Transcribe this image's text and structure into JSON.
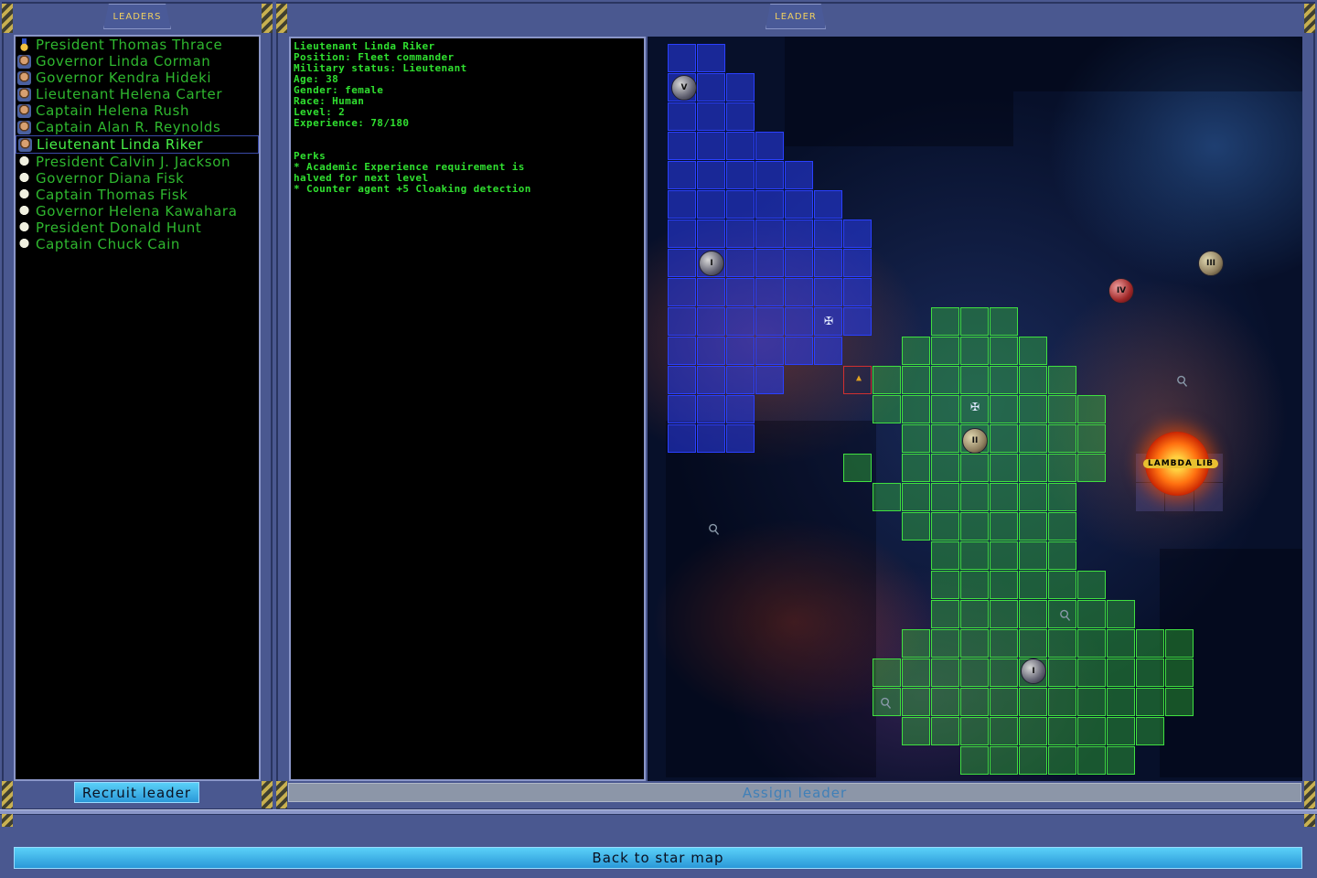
{
  "leaders_panel": {
    "tab_label": "LEADERS",
    "items": [
      {
        "label": "President Thomas Thrace",
        "icon": "medal-icon",
        "selected": false
      },
      {
        "label": "Governor Linda Corman",
        "icon": "governor-portrait-icon",
        "selected": false
      },
      {
        "label": "Governor Kendra Hideki",
        "icon": "governor-portrait-icon",
        "selected": false
      },
      {
        "label": "Lieutenant Helena Carter",
        "icon": "officer-portrait-icon",
        "selected": false
      },
      {
        "label": "Captain Helena Rush",
        "icon": "officer-portrait-icon",
        "selected": false
      },
      {
        "label": "Captain Alan R. Reynolds",
        "icon": "officer-portrait-icon",
        "selected": false
      },
      {
        "label": "Lieutenant Linda Riker",
        "icon": "officer-portrait-icon",
        "selected": true
      },
      {
        "label": "President Calvin J. Jackson",
        "icon": "skull-icon",
        "selected": false
      },
      {
        "label": "Governor Diana Fisk",
        "icon": "skull-icon",
        "selected": false
      },
      {
        "label": "Captain Thomas Fisk",
        "icon": "skull-icon",
        "selected": false
      },
      {
        "label": "Governor Helena Kawahara",
        "icon": "skull-icon",
        "selected": false
      },
      {
        "label": "President Donald Hunt",
        "icon": "skull-icon",
        "selected": false
      },
      {
        "label": "Captain Chuck Cain",
        "icon": "skull-icon",
        "selected": false
      }
    ],
    "recruit_button": "Recruit leader"
  },
  "leader_panel": {
    "tab_label": "LEADER",
    "info_lines": [
      "Lieutenant Linda Riker",
      "Position: Fleet commander",
      "Military status: Lieutenant",
      "Age: 38",
      "Gender: female",
      "Race: Human",
      "Level: 2",
      "Experience: 78/180"
    ],
    "perks_title": "Perks",
    "perk_lines": [
      "* Academic Experience requirement is",
      "halved for next level",
      "* Counter agent +5 Cloaking detection"
    ],
    "assign_button": "Assign leader"
  },
  "map": {
    "planets": [
      {
        "label": "V",
        "style": "grey"
      },
      {
        "label": "I",
        "style": "grey"
      },
      {
        "label": "IV",
        "style": "red"
      },
      {
        "label": "III",
        "style": "sand"
      },
      {
        "label": "II",
        "style": "sand"
      },
      {
        "label": "I",
        "style": "grey"
      }
    ],
    "sun_label": "LAMBDA LIB",
    "colors": {
      "blue_territory": "#2a40ff",
      "green_territory": "#40e040"
    }
  },
  "footer": {
    "back_button": "Back to star map"
  }
}
